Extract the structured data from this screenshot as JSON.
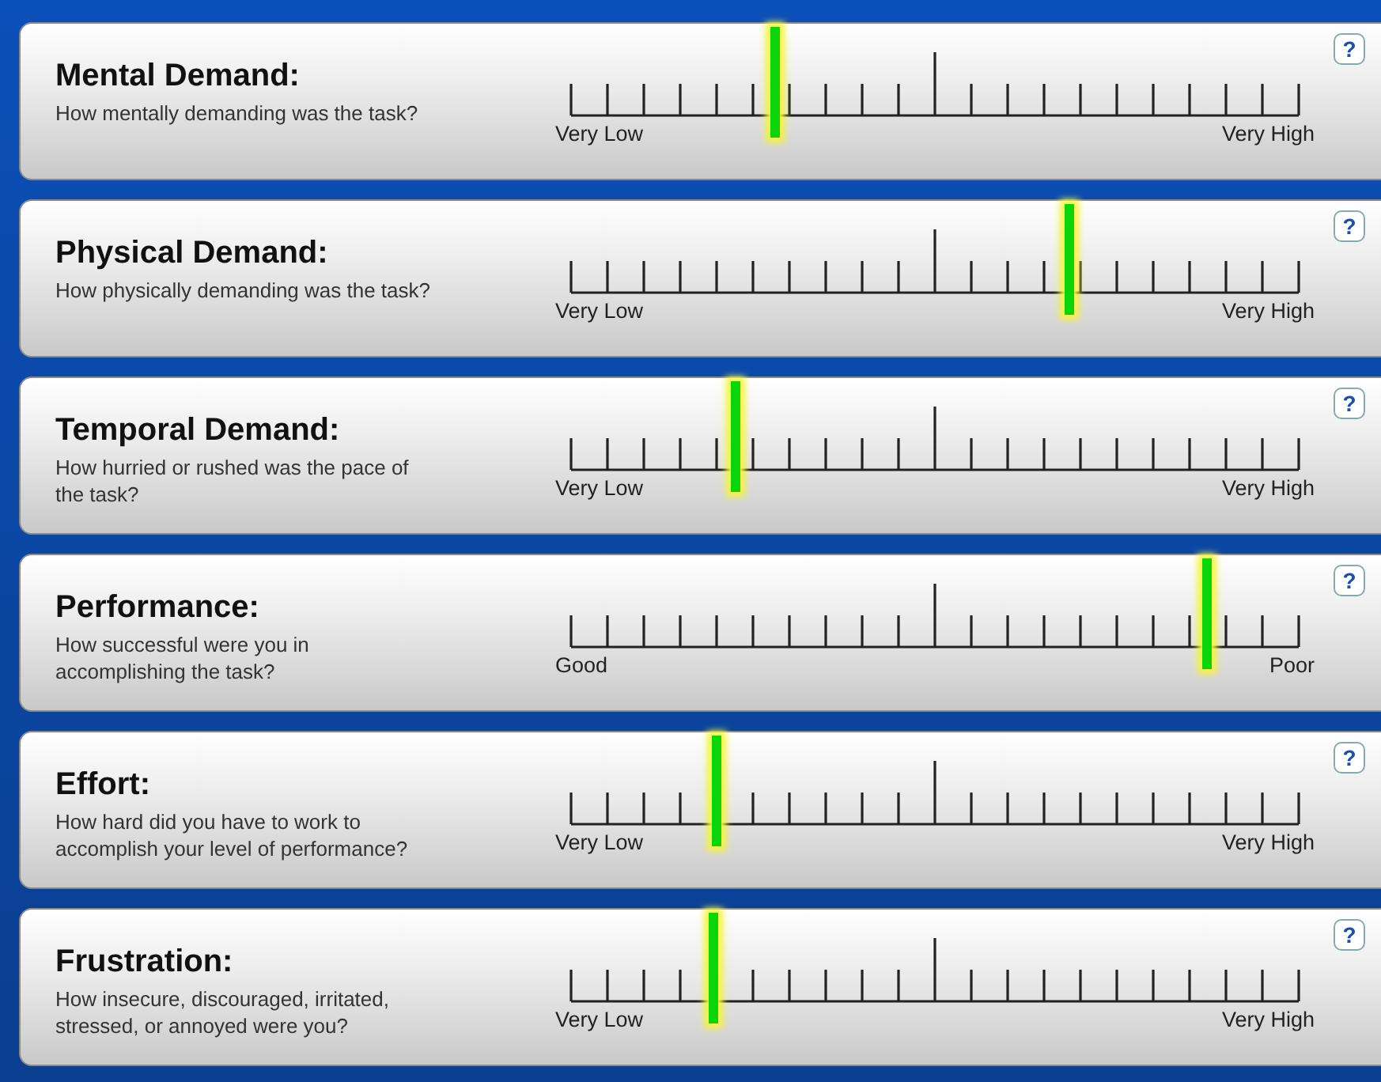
{
  "scales": [
    {
      "title": "Mental Demand:",
      "question": "How mentally demanding was the task?",
      "low_label": "Very Low",
      "high_label": "Very High",
      "level": 0.28,
      "help": "?"
    },
    {
      "title": "Physical Demand:",
      "question": "How physically demanding was the task?",
      "low_label": "Very Low",
      "high_label": "Very High",
      "level": 0.685,
      "help": "?"
    },
    {
      "title": "Temporal Demand:",
      "question": "How hurried or rushed was the pace of the task?",
      "low_label": "Very Low",
      "high_label": "Very High",
      "level": 0.226,
      "help": "?"
    },
    {
      "title": "Performance:",
      "question": "How successful were you in accomplishing the task?",
      "low_label": "Good",
      "high_label": "Poor",
      "level": 0.874,
      "help": "?"
    },
    {
      "title": "Effort:",
      "question": "How hard did you have to work to accomplish your level of performance?",
      "low_label": "Very Low",
      "high_label": "Very High",
      "level": 0.2,
      "help": "?"
    },
    {
      "title": "Frustration:",
      "question": "How insecure, discouraged, irritated, stressed, or annoyed were you?",
      "low_label": "Very Low",
      "high_label": "Very High",
      "level": 0.196,
      "help": "?"
    }
  ]
}
